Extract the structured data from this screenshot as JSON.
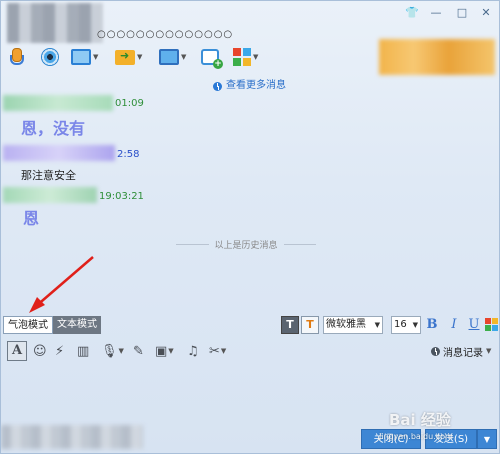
{
  "window": {
    "title": "○○○○○○○○○○○○○○",
    "controls": {
      "skin": "👕",
      "minimize": "—",
      "maximize": "□",
      "close": "✕"
    }
  },
  "toolbar": {
    "items": [
      {
        "name": "voice",
        "icon": "microphone-icon"
      },
      {
        "name": "video",
        "icon": "webcam-icon"
      },
      {
        "name": "screen-share",
        "icon": "screen-icon"
      },
      {
        "name": "file-transfer",
        "icon": "folder-send-icon"
      },
      {
        "name": "remote-desktop",
        "icon": "monitor-icon"
      },
      {
        "name": "new-discussion",
        "icon": "message-plus-icon"
      },
      {
        "name": "apps",
        "icon": "apps-grid-icon"
      }
    ]
  },
  "chat": {
    "view_more": "查看更多消息",
    "messages": [
      {
        "time_suffix": "01:09",
        "text": "恩，没有",
        "big": true
      },
      {
        "time_suffix": "2:58",
        "text": "那注意安全",
        "big": false
      },
      {
        "time_suffix": "19:03:21",
        "text": "恩",
        "big": true
      }
    ],
    "history_divider": "以上是历史消息",
    "colors": {
      "sender_green": "#2f8f3a",
      "sender_blue": "#2a4fc9",
      "bubble_text": "#7a86e8"
    }
  },
  "modebar": {
    "bubble_mode": "气泡模式",
    "text_mode": "文本模式",
    "font_name": "微软雅黑",
    "font_size": "16",
    "bold": "B",
    "italic": "I",
    "underline": "U"
  },
  "inputbar": {
    "history_label": "消息记录"
  },
  "bottom": {
    "close_label": "关闭(C)",
    "send_label": "发送(S)"
  },
  "watermark": {
    "text": "Bai 经验",
    "url": "jingyan.baidu.com"
  }
}
